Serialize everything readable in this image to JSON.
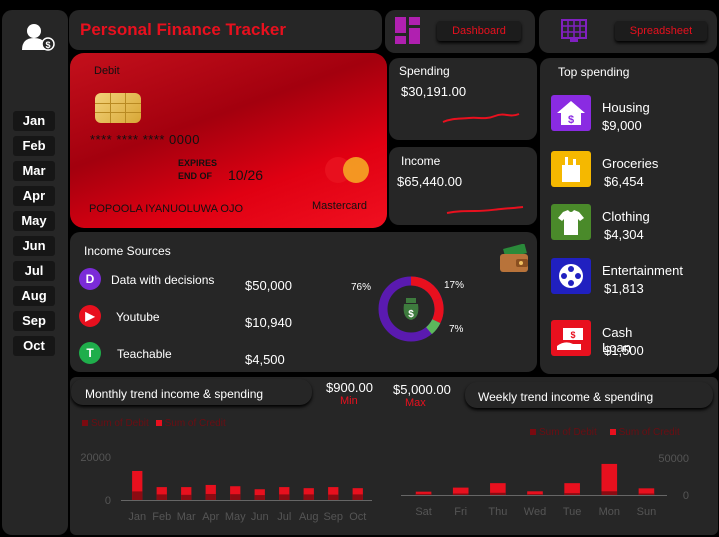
{
  "header": {
    "title": "Personal Finance  Tracker"
  },
  "nav": {
    "dashboard": "Dashboard",
    "spreadsheet": "Spreadsheet"
  },
  "sidebar": {
    "months": [
      "Jan",
      "Feb",
      "Mar",
      "Apr",
      "May",
      "Jun",
      "Jul",
      "Aug",
      "Sep",
      "Oct"
    ]
  },
  "card": {
    "label": "Debit",
    "number": "**** **** **** 0000",
    "expires_label_1": "EXPIRES",
    "expires_label_2": "END OF",
    "expiry": "10/26",
    "holder": "POPOOLA IYANUOLUWA OJO",
    "network": "Mastercard"
  },
  "spending": {
    "label": "Spending",
    "value": "$30,191.00"
  },
  "income": {
    "label": "Income",
    "value": "$65,440.00"
  },
  "top_spending": {
    "title": "Top spending",
    "items": [
      {
        "name": "Housing",
        "value": "$9,000",
        "icon": "house-dollar-icon",
        "color": "#8a2be2"
      },
      {
        "name": "Groceries",
        "value": "$6,454",
        "icon": "grocery-bag-icon",
        "color": "#f5b800"
      },
      {
        "name": "Clothing",
        "value": "$4,304",
        "icon": "shirt-icon",
        "color": "#4a8a2a"
      },
      {
        "name": "Entertainment",
        "value": "$1,813",
        "icon": "film-reel-icon",
        "color": "#2020c0"
      },
      {
        "name": "Cash Loan",
        "value": "$1,500",
        "icon": "cash-hand-icon",
        "color": "#e8101e"
      }
    ]
  },
  "income_sources": {
    "title": "Income Sources",
    "items": [
      {
        "name": "Data with decisions",
        "value": "$50,000",
        "icon": "data-with-decisions-icon",
        "color": "#7b2bd8"
      },
      {
        "name": "Youtube",
        "value": "$10,940",
        "icon": "youtube-icon",
        "color": "#e8101e"
      },
      {
        "name": "Teachable",
        "value": "$4,500",
        "icon": "teachable-icon",
        "color": "#1fae4b"
      }
    ],
    "donut_labels": {
      "p1": "76%",
      "p2": "17%",
      "p3": "7%"
    }
  },
  "stats": {
    "min_value": "$900.00",
    "min_label": "Min",
    "max_value": "$5,000.00",
    "max_label": "Max"
  },
  "monthly_tab": "Monthly  trend income & spending",
  "weekly_tab": "Weekly trend income & spending",
  "chart_data": [
    {
      "type": "bar",
      "title": "Monthly  trend income & spending",
      "categories": [
        "Jan",
        "Feb",
        "Mar",
        "Apr",
        "May",
        "Jun",
        "Jul",
        "Aug",
        "Sep",
        "Oct"
      ],
      "series": [
        {
          "name": "Sum of Debit",
          "values": [
            4000,
            2600,
            2400,
            2800,
            2700,
            2300,
            2600,
            2600,
            2500,
            2600
          ],
          "color": "#7a0a10"
        },
        {
          "name": "Sum of Credit",
          "values": [
            13500,
            6000,
            6000,
            7000,
            6400,
            5000,
            6000,
            5500,
            6000,
            5500
          ],
          "color": "#e8101e"
        }
      ],
      "yticks": [
        "0",
        "20000"
      ],
      "ylim": [
        0,
        20000
      ],
      "legend": "top-left"
    },
    {
      "type": "bar",
      "title": "Weekly trend income & spending",
      "categories": [
        "Sat",
        "Fri",
        "Thu",
        "Wed",
        "Tue",
        "Mon",
        "Sun"
      ],
      "series": [
        {
          "name": "Sum of Debit",
          "values": [
            1500,
            2000,
            3000,
            1200,
            2500,
            5000,
            2000
          ],
          "color": "#7a0a10"
        },
        {
          "name": "Sum of Credit",
          "values": [
            4500,
            10000,
            16000,
            5000,
            16000,
            42000,
            9000
          ],
          "color": "#e8101e"
        }
      ],
      "yticks": [
        "0",
        "50000"
      ],
      "ylim": [
        0,
        50000
      ],
      "legend": "top-right"
    }
  ]
}
